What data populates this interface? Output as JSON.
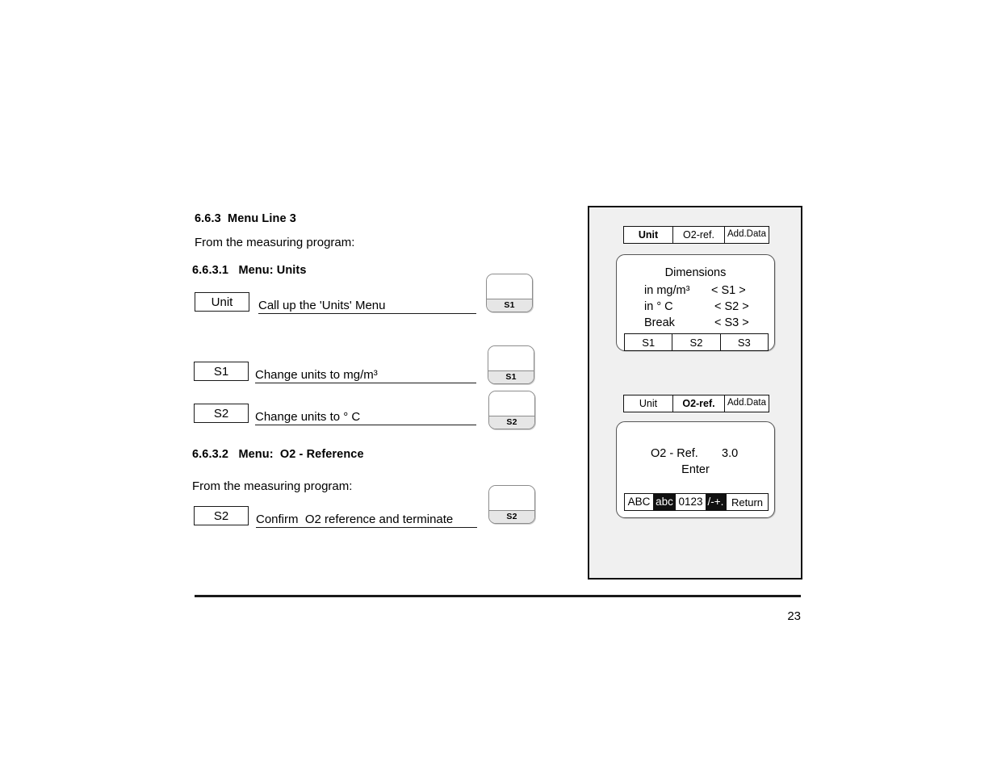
{
  "document": {
    "page_number": "23",
    "section": {
      "number": "6.6.3",
      "title": "Menu Line 3"
    },
    "intro_1": "From the measuring program:",
    "subsection_1": {
      "number": "6.6.3.1",
      "title": "Menu: Units"
    },
    "subsection_2": {
      "number": "6.6.3.2",
      "title": "Menu:  O2 - Reference"
    },
    "intro_2": "From the measuring program:"
  },
  "steps": [
    {
      "key_label": "Unit",
      "action": "Call up the 'Units' Menu",
      "hardware_key": "S1"
    },
    {
      "key_label": "S1",
      "action": "Change units to mg/m³",
      "hardware_key": "S1"
    },
    {
      "key_label": "S2",
      "action": "Change units to ° C",
      "hardware_key": "S2"
    },
    {
      "key_label": "S2",
      "action": "Confirm  O2 reference and terminate",
      "hardware_key": "S2"
    }
  ],
  "device_panel": {
    "screen_units": {
      "tabs": [
        {
          "label": "Unit",
          "selected": true
        },
        {
          "label": "O2-ref.",
          "selected": false
        },
        {
          "label": "Add.Data",
          "selected": false
        }
      ],
      "lcd_title": "Dimensions",
      "lcd_rows": [
        {
          "left": "in mg/m³",
          "right": "< S1 >"
        },
        {
          "left": "in ° C",
          "right": "< S2 >"
        },
        {
          "left": "Break",
          "right": "< S3 >"
        }
      ],
      "softkeys": [
        "S1",
        "S2",
        "S3"
      ]
    },
    "screen_o2ref": {
      "tabs": [
        {
          "label": "Unit",
          "selected": false
        },
        {
          "label": "O2-ref.",
          "selected": true
        },
        {
          "label": "Add.Data",
          "selected": false
        }
      ],
      "value_label": "O2 - Ref.",
      "value": "3.0",
      "prompt": "Enter",
      "charset_cells": [
        {
          "label": "ABC",
          "inverted": false
        },
        {
          "label": "abc",
          "inverted": true
        },
        {
          "label": "0123",
          "inverted": false
        },
        {
          "label": "/-+.",
          "inverted": true
        }
      ],
      "return_label": "Return"
    }
  },
  "colors": {
    "panel_background": "#f0f0f0",
    "panel_border": "#111111",
    "ink": "#1a1a1a",
    "key_cap_label_bg": "#e6e6e6",
    "inverted_bg": "#111111"
  }
}
